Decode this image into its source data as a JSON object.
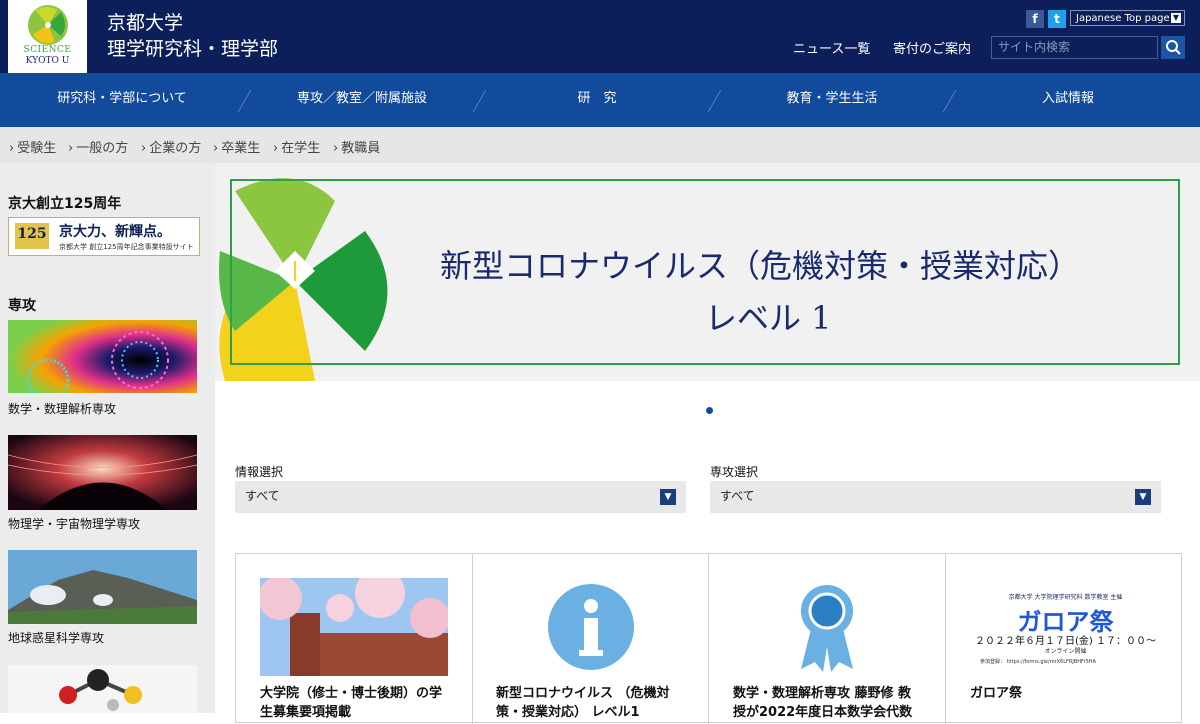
{
  "header": {
    "logo_line1": "SCIENCE",
    "logo_line2": "KYOTO U",
    "site_name_line1": "京都大学",
    "site_name_line2": "理学研究科・理学部",
    "facebook": "f",
    "twitter": "t",
    "lang_select": "Japanese Top page",
    "links": [
      "ニュース一覧",
      "寄付のご案内"
    ],
    "search_placeholder": "サイト内検索"
  },
  "global_nav": [
    "研究科・学部について",
    "専攻／教室／附属施設",
    "研　究",
    "教育・学生生活",
    "入試情報"
  ],
  "sub_nav": [
    "受験生",
    "一般の方",
    "企業の方",
    "卒業生",
    "在学生",
    "教職員"
  ],
  "sidebar": {
    "anniversary_heading": "京大創立125周年",
    "anniversary_banner": {
      "num": "125",
      "main": "京大力、新輝点。",
      "sub": "京都大学 創立125周年記念事業特設サイト"
    },
    "majors_heading": "専攻",
    "majors": [
      "数学・数理解析専攻",
      "物理学・宇宙物理学専攻",
      "地球惑星科学専攻"
    ]
  },
  "banner": {
    "title_line1": "新型コロナウイルス（危機対策・授業対応）",
    "title_line2": "レベル 1"
  },
  "filters": {
    "info_label": "情報選択",
    "info_value": "すべて",
    "major_label": "専攻選択",
    "major_value": "すべて"
  },
  "cards": [
    {
      "title": "大学院（修士・博士後期）の学生募集要項掲載"
    },
    {
      "title": "新型コロナウイルス （危機対策・授業対応） レベル1"
    },
    {
      "title": "数学・数理解析専攻 藤野修 教授が2022年度日本数学会代数"
    },
    {
      "title": "ガロア祭",
      "poster_org": "京都大学 大学院理学研究科 数学教室 主催",
      "poster_title": "ガロア祭",
      "poster_date": "２０２２年６月１７日(金) １７：００～",
      "poster_mode": "オンライン開催",
      "poster_reg": "参加登録： https://forms.gle/mrX6LFRJBHFr5HA"
    }
  ],
  "colors": {
    "header_bg": "#0d1f5a",
    "nav_bg": "#124a9c",
    "accent_green": "#2f9f4a"
  }
}
